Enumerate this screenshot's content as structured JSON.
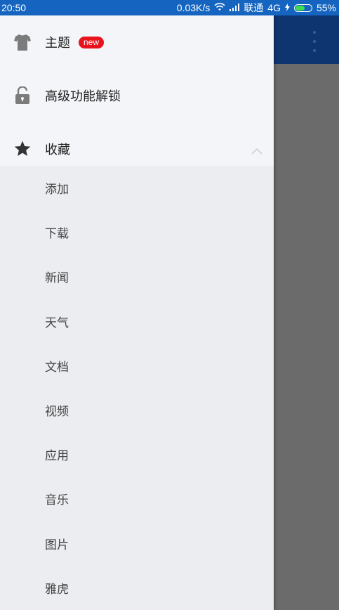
{
  "status_bar": {
    "time": "20:50",
    "speed": "0.03K/s",
    "carrier": "联通",
    "network": "4G",
    "battery": "55%"
  },
  "drawer": {
    "top_items": [
      {
        "label": "主题",
        "icon": "tshirt-icon",
        "badge": "new"
      },
      {
        "label": "高级功能解锁",
        "icon": "unlock-icon"
      },
      {
        "label": "收藏",
        "icon": "star-icon",
        "expanded": true
      }
    ],
    "favorites": [
      "添加",
      "下载",
      "新闻",
      "天气",
      "文档",
      "视频",
      "应用",
      "音乐",
      "图片",
      "雅虎"
    ]
  },
  "colors": {
    "status_bar": "#1565c0",
    "toolbar": "#0e3570",
    "badge": "#e8141c",
    "scrim": "#6b6b6b"
  }
}
